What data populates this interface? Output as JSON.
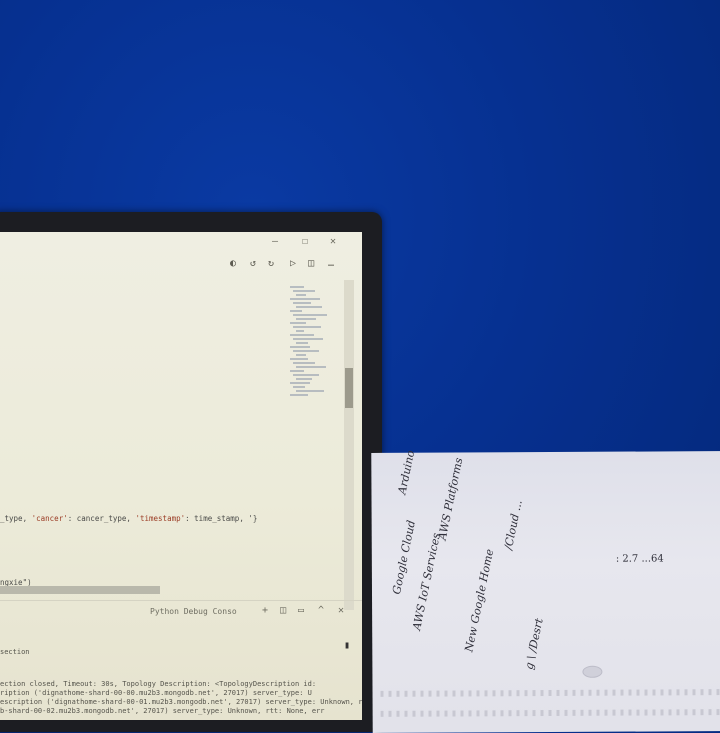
{
  "editor": {
    "code_lines": [
      {
        "parts": [
          {
            "t": "_type, ",
            "s": false
          },
          {
            "t": "'cancer'",
            "s": true
          },
          {
            "t": ": cancer_type, ",
            "s": false
          },
          {
            "t": "'timestamp'",
            "s": true
          },
          {
            "t": ": time_stamp, '}",
            "s": false
          }
        ]
      },
      {
        "parts": [
          {
            "t": "ngxie\")",
            "s": false
          }
        ]
      }
    ]
  },
  "panel": {
    "label": "Python Debug Conso"
  },
  "terminal": {
    "lines": [
      "section",
      "ection closed, Timeout: 30s, Topology Description: <TopologyDescription id:",
      "ription ('dignathome-shard-00-00.mu2b3.mongodb.net', 27017) server_type: U",
      "escription ('dignathome-shard-00-01.mu2b3.mongodb.net', 27017) server_type: Unknown, rtt",
      "b-shard-00-02.mu2b3.mongodb.net', 27017) server_type: Unknown, rtt: None, err"
    ]
  },
  "notebook": {
    "handwriting": [
      "Google Cloud",
      "AWS IoT Services",
      "New Google Home",
      "g \\ /Desrt",
      "Arduino",
      "/Cloud ...",
      "AWS Platforms"
    ],
    "number_note": ": 2.7 ...64"
  }
}
